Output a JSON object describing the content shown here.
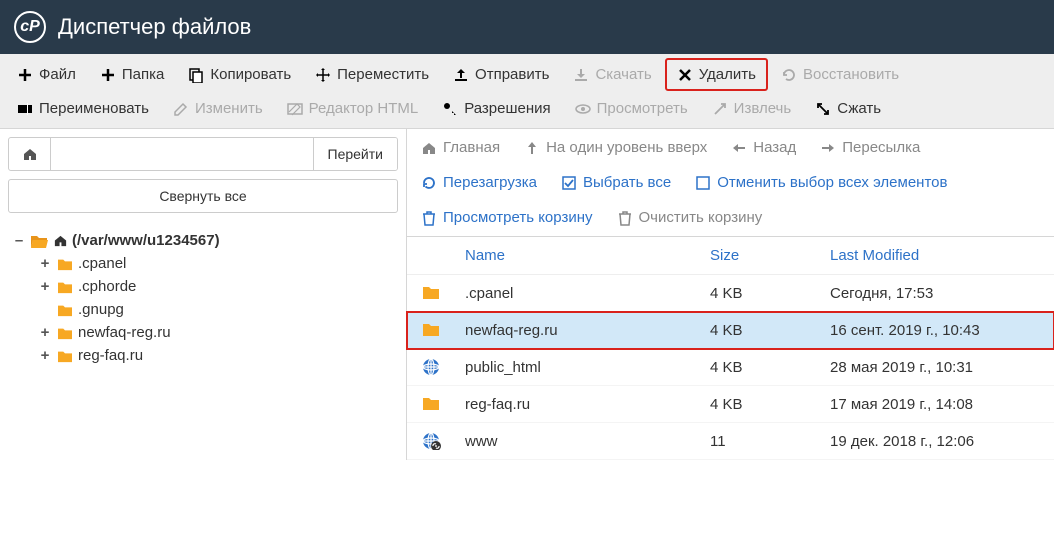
{
  "header": {
    "title": "Диспетчер файлов"
  },
  "toolbar": [
    {
      "id": "file",
      "label": "Файл",
      "icon": "plus",
      "disabled": false
    },
    {
      "id": "folder",
      "label": "Папка",
      "icon": "plus",
      "disabled": false
    },
    {
      "id": "copy",
      "label": "Копировать",
      "icon": "copy",
      "disabled": false
    },
    {
      "id": "move",
      "label": "Переместить",
      "icon": "move",
      "disabled": false
    },
    {
      "id": "upload",
      "label": "Отправить",
      "icon": "upload",
      "disabled": false
    },
    {
      "id": "download",
      "label": "Скачать",
      "icon": "download",
      "disabled": true
    },
    {
      "id": "delete",
      "label": "Удалить",
      "icon": "close",
      "disabled": false,
      "highlight": true
    },
    {
      "id": "restore",
      "label": "Восстановить",
      "icon": "restore",
      "disabled": true
    },
    {
      "id": "rename",
      "label": "Переименовать",
      "icon": "rename",
      "disabled": false
    },
    {
      "id": "edit",
      "label": "Изменить",
      "icon": "edit",
      "disabled": true
    },
    {
      "id": "htmledit",
      "label": "Редактор HTML",
      "icon": "htmledit",
      "disabled": true
    },
    {
      "id": "perms",
      "label": "Разрешения",
      "icon": "key",
      "disabled": false
    },
    {
      "id": "view",
      "label": "Просмотреть",
      "icon": "eye",
      "disabled": true
    },
    {
      "id": "extract",
      "label": "Извлечь",
      "icon": "extract",
      "disabled": true
    },
    {
      "id": "compress",
      "label": "Сжать",
      "icon": "compress",
      "disabled": false
    }
  ],
  "sidebar": {
    "path_value": "",
    "go_label": "Перейти",
    "collapse_label": "Свернуть все",
    "root": {
      "label": "(/var/www/u1234567)",
      "expanded": true,
      "children": [
        {
          "label": ".cpanel",
          "has_children": true
        },
        {
          "label": ".cphorde",
          "has_children": true
        },
        {
          "label": ".gnupg",
          "has_children": false
        },
        {
          "label": "newfaq-reg.ru",
          "has_children": true
        },
        {
          "label": "reg-faq.ru",
          "has_children": true
        }
      ]
    }
  },
  "main_toolbar": [
    {
      "id": "home",
      "label": "Главная",
      "icon": "home",
      "style": "gray"
    },
    {
      "id": "up",
      "label": "На один уровень вверх",
      "icon": "arrow-up",
      "style": "gray"
    },
    {
      "id": "back",
      "label": "Назад",
      "icon": "arrow-left",
      "style": "gray"
    },
    {
      "id": "forward",
      "label": "Пересылка",
      "icon": "arrow-right",
      "style": "gray"
    },
    {
      "id": "reload",
      "label": "Перезагрузка",
      "icon": "reload",
      "style": "blue"
    },
    {
      "id": "selectall",
      "label": "Выбрать все",
      "icon": "check-box",
      "style": "blue"
    },
    {
      "id": "deselect",
      "label": "Отменить выбор всех элементов",
      "icon": "box",
      "style": "blue"
    },
    {
      "id": "viewtrash",
      "label": "Просмотреть корзину",
      "icon": "trash",
      "style": "blue"
    },
    {
      "id": "emptytrash",
      "label": "Очистить корзину",
      "icon": "trash",
      "style": "gray"
    }
  ],
  "table": {
    "headers": {
      "name": "Name",
      "size": "Size",
      "modified": "Last Modified"
    },
    "rows": [
      {
        "icon": "folder",
        "name": ".cpanel",
        "size": "4 KB",
        "modified": "Сегодня, 17:53",
        "selected": false
      },
      {
        "icon": "folder",
        "name": "newfaq-reg.ru",
        "size": "4 KB",
        "modified": "16 сент. 2019 г., 10:43",
        "selected": true
      },
      {
        "icon": "globe",
        "name": "public_html",
        "size": "4 KB",
        "modified": "28 мая 2019 г., 10:31",
        "selected": false
      },
      {
        "icon": "folder",
        "name": "reg-faq.ru",
        "size": "4 KB",
        "modified": "17 мая 2019 г., 14:08",
        "selected": false
      },
      {
        "icon": "globe-link",
        "name": "www",
        "size": "11",
        "modified": "19 дек. 2018 г., 12:06",
        "selected": false
      }
    ]
  }
}
